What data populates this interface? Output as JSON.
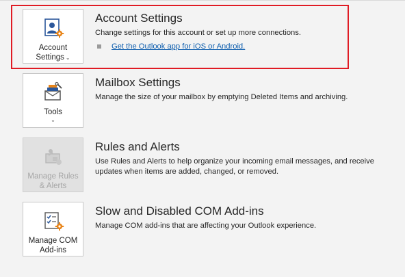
{
  "sections": [
    {
      "tile_label": "Account Settings",
      "tile_line1": "Account",
      "tile_line2": "Settings",
      "title": "Account Settings",
      "description": "Change settings for this account or set up more connections.",
      "link": "Get the Outlook app for iOS or Android.",
      "icon": "account-settings-icon"
    },
    {
      "tile_line1": "Tools",
      "title": "Mailbox Settings",
      "description": "Manage the size of your mailbox by emptying Deleted Items and archiving.",
      "icon": "tools-icon"
    },
    {
      "tile_line1": "Manage Rules",
      "tile_line2": "& Alerts",
      "title": "Rules and Alerts",
      "description": "Use Rules and Alerts to help organize your incoming email messages, and receive updates when items are added, changed, or removed.",
      "icon": "rules-alerts-icon",
      "disabled": true
    },
    {
      "tile_line1": "Manage COM",
      "tile_line2": "Add-ins",
      "title": "Slow and Disabled COM Add-ins",
      "description": "Manage COM add-ins that are affecting your Outlook experience.",
      "icon": "com-addins-icon"
    }
  ],
  "colors": {
    "highlight": "#e01b24",
    "link": "#0b5cad",
    "accent": "#e8851a",
    "icon_blue": "#2b579a"
  }
}
